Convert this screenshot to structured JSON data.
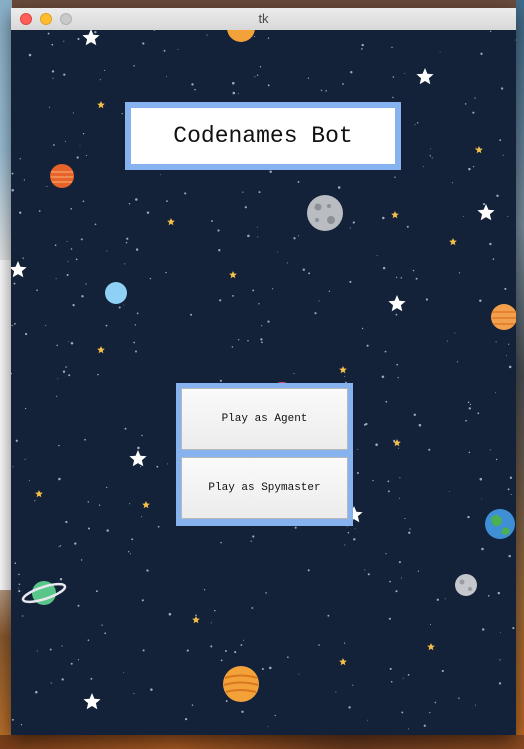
{
  "window": {
    "title": "tk",
    "controls": [
      "close",
      "minimize",
      "zoom"
    ]
  },
  "app": {
    "title": "Codenames Bot",
    "buttons": {
      "agent_label": "Play as Agent",
      "spymaster_label": "Play as Spymaster"
    }
  },
  "colors": {
    "background": "#132238",
    "frame_accent": "#86b3f0",
    "button_face": "#f2f2f2"
  },
  "decor": {
    "background_theme": "space-stars-planets"
  }
}
